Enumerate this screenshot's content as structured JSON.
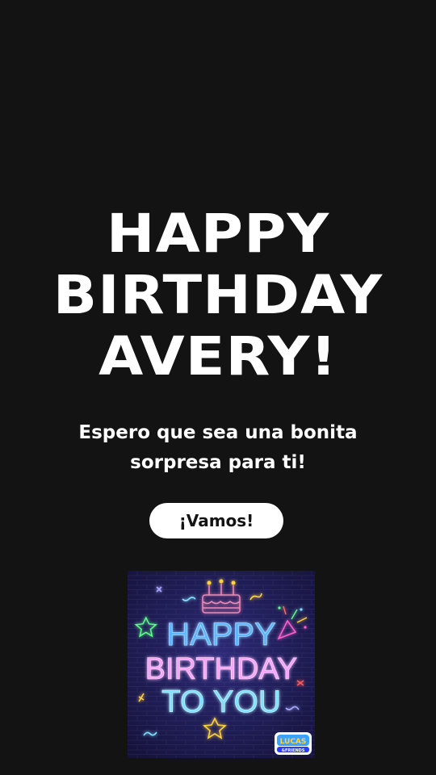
{
  "headline": {
    "line1": "HAPPY",
    "line2": "BIRTHDAY",
    "line3": "AVERY!"
  },
  "subtitle": "Espero que sea una bonita sorpresa para ti!",
  "cta_label": "¡Vamos!",
  "card": {
    "line1": "HAPPY",
    "line2": "BIRTHDAY",
    "line3": "TO YOU",
    "logo_text": "LUCAS & FRIENDS",
    "colors": {
      "background": "#1d1a52",
      "line1": "#5fb8ff",
      "line2": "#f7a4ff",
      "line3": "#7fe0ff",
      "accent_yellow": "#ffd23f",
      "accent_green": "#5dff8a"
    }
  },
  "colors": {
    "page_background": "#131313",
    "text": "#ffffff",
    "button_background": "#ffffff",
    "button_text": "#131313"
  }
}
